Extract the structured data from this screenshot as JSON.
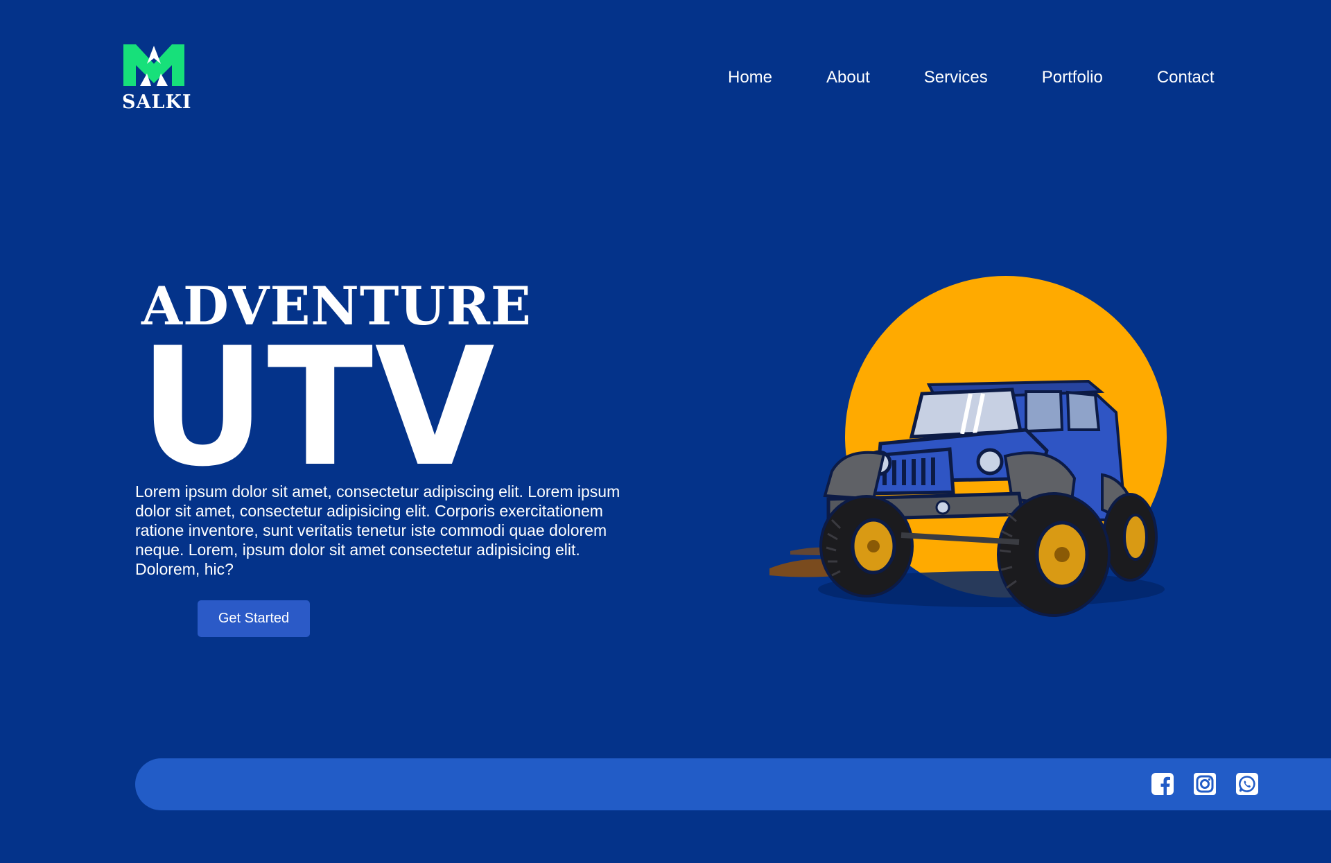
{
  "brand": {
    "name": "SALKI",
    "logo_icon": "crown-m-logo",
    "accent_color": "#17e07a"
  },
  "nav": {
    "items": [
      {
        "label": "Home"
      },
      {
        "label": "About"
      },
      {
        "label": "Services"
      },
      {
        "label": "Portfolio"
      },
      {
        "label": "Contact"
      }
    ]
  },
  "hero": {
    "title_top": "ADVENTURE",
    "title_main": "UTV",
    "description": "Lorem ipsum dolor sit amet, consectetur adipiscing elit. Lorem ipsum dolor sit amet, consectetur adipisicing elit. Corporis exercitationem ratione inventore, sunt veritatis tenetur iste commodi quae dolorem neque. Lorem, ipsum dolor sit amet consectetur adipisicing elit. Dolorem, hic?",
    "cta_label": "Get Started",
    "image_icon": "jeep-with-sun-illustration",
    "sun_color": "#ffaa00",
    "jeep_color": "#2f55c4"
  },
  "footer": {
    "social": [
      {
        "icon": "facebook-icon"
      },
      {
        "icon": "instagram-icon"
      },
      {
        "icon": "whatsapp-icon"
      }
    ]
  },
  "colors": {
    "background": "#04338a",
    "bar": "#225cc7",
    "button": "#2b5ac7",
    "text": "#ffffff"
  }
}
